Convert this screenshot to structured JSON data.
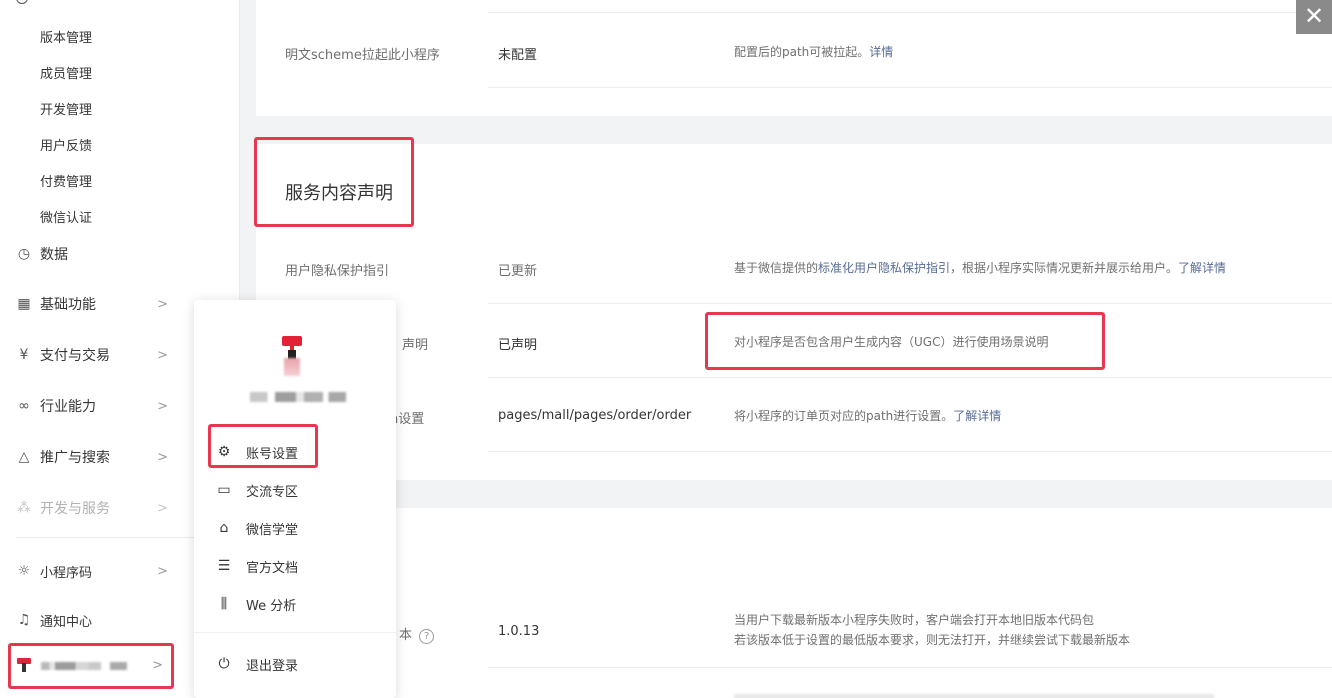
{
  "sidebar": {
    "sub_items": [
      "版本管理",
      "成员管理",
      "开发管理",
      "用户反馈",
      "付费管理",
      "微信认证"
    ],
    "nav": [
      {
        "label": "数据",
        "icon": "clock-icon",
        "chevron": false
      },
      {
        "label": "基础功能",
        "icon": "grid-icon",
        "chevron": true
      },
      {
        "label": "支付与交易",
        "icon": "yen-circle-icon",
        "chevron": true
      },
      {
        "label": "行业能力",
        "icon": "nodes-icon",
        "chevron": true
      },
      {
        "label": "推广与搜索",
        "icon": "cone-icon",
        "chevron": true
      },
      {
        "label": "开发与服务",
        "icon": "cluster-icon",
        "chevron": true,
        "disabled": true
      },
      {
        "label": "小程序码",
        "icon": "sun-icon",
        "chevron": true
      },
      {
        "label": "通知中心",
        "icon": "bell-icon",
        "chevron": false
      }
    ],
    "chevron_glyph": ">"
  },
  "section1": {
    "row_scheme": {
      "label": "明文scheme拉起此小程序",
      "value": "未配置",
      "desc": "配置后的path可被拉起。",
      "link": "详情"
    }
  },
  "section2": {
    "title": "服务内容声明",
    "row_privacy": {
      "label": "用户隐私保护指引",
      "value": "已更新",
      "desc_prefix": "基于微信提供的",
      "desc_link": "标准化用户隐私保护指引",
      "desc_suffix": "，根据小程序实际情况更新并展示给用户。",
      "link": "了解详情"
    },
    "row_ugc": {
      "label_visible": "声明",
      "value": "已声明",
      "desc": "对小程序是否包含用户生成内容（UGC）进行使用场景说明"
    },
    "row_path": {
      "label_visible": "h设置",
      "value": "pages/mall/pages/order/order",
      "desc": "将小程序的订单页对应的path进行设置。",
      "link": "了解详情"
    }
  },
  "section3": {
    "row_version": {
      "label_visible": "本",
      "help_glyph": "?",
      "value": "1.0.13",
      "desc_line1": "当用户下载最新版本小程序失败时，客户端会打开本地旧版本代码包",
      "desc_line2": "若该版本低于设置的最低版本要求，则无法打开，并继续尝试下载最新版本"
    }
  },
  "popup": {
    "items": [
      {
        "label": "账号设置",
        "icon": "gear-icon"
      },
      {
        "label": "交流专区",
        "icon": "chat-icon"
      },
      {
        "label": "微信学堂",
        "icon": "graduation-cap-icon"
      },
      {
        "label": "官方文档",
        "icon": "document-icon"
      },
      {
        "label": "We 分析",
        "icon": "analytics-icon"
      }
    ],
    "logout": {
      "label": "退出登录",
      "icon": "power-icon"
    }
  },
  "close_glyph": "✕",
  "colors": {
    "highlight": "#e8384f",
    "link": "#576b95"
  }
}
